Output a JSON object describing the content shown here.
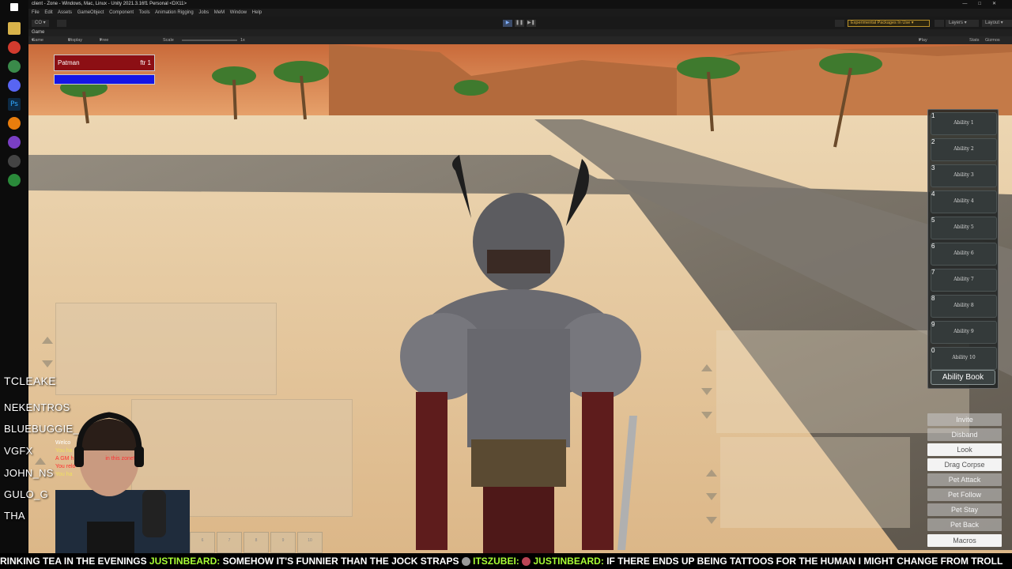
{
  "window": {
    "title": "client - Zone - Windows, Mac, Linux - Unity 2021.3.16f1 Personal <DX11>",
    "controls": [
      "—",
      "□",
      "✕"
    ]
  },
  "menu": [
    "File",
    "Edit",
    "Assets",
    "GameObject",
    "Component",
    "Tools",
    "Animation Rigging",
    "Jobs",
    "MeM",
    "Window",
    "Help"
  ],
  "toolbar": {
    "account": "CO",
    "experimental": "Experimental Packages In Use ▾",
    "layers": "Layers",
    "layout": "Layout"
  },
  "game_tab": {
    "label": "Game"
  },
  "game_controls": {
    "view": "Game",
    "display": "Display 1",
    "aspect": "Free Aspect",
    "scale_label": "Scale",
    "scale_value": "1x",
    "play_focused": "Play Focused",
    "stats": "Stats",
    "gizmos": "Gizmos"
  },
  "player": {
    "name": "Patman",
    "level_label": "ftr 1",
    "health_fraction": 1.0,
    "mana_fraction": 1.0
  },
  "abilities": [
    {
      "num": "1",
      "label": "Ability 1"
    },
    {
      "num": "2",
      "label": "Ability 2"
    },
    {
      "num": "3",
      "label": "Ability 3"
    },
    {
      "num": "4",
      "label": "Ability 4"
    },
    {
      "num": "5",
      "label": "Ability 5"
    },
    {
      "num": "6",
      "label": "Ability 6"
    },
    {
      "num": "7",
      "label": "Ability 7"
    },
    {
      "num": "8",
      "label": "Ability 8"
    },
    {
      "num": "9",
      "label": "Ability 9"
    },
    {
      "num": "0",
      "label": "Ability 10"
    }
  ],
  "ability_book": "Ability Book",
  "group_buttons": [
    {
      "label": "Invite",
      "enabled": false
    },
    {
      "label": "Disband",
      "enabled": false
    },
    {
      "label": "Look",
      "enabled": true
    },
    {
      "label": "Drag Corpse",
      "enabled": true
    },
    {
      "label": "Pet Attack",
      "enabled": false
    },
    {
      "label": "Pet Follow",
      "enabled": false
    },
    {
      "label": "Pet Stay",
      "enabled": false
    },
    {
      "label": "Pet Back",
      "enabled": false
    },
    {
      "label": "Macros",
      "enabled": true
    }
  ],
  "chat": [
    {
      "text": "Welco",
      "color": "#ffffff"
    },
    {
      "text": "You ha",
      "color": "#f0e060"
    },
    {
      "text": "A GM h",
      "color": "#ff3030"
    },
    {
      "text": "in this zone!",
      "color": "#ff3030"
    },
    {
      "text": "You relo",
      "color": "#ff3030"
    },
    {
      "text": "You ha",
      "color": "#f0e060"
    }
  ],
  "hotbar_slots": [
    "6",
    "7",
    "8",
    "9",
    "10"
  ],
  "stream": {
    "viewers": [
      "TCLEAKE",
      "NEKENTROS",
      "BLUEBUGGIE_",
      "VGFX",
      "JOHN_NS",
      "GULO_G",
      "THA"
    ],
    "ticker": [
      {
        "type": "msg",
        "text": "RINKING TEA IN THE EVENINGS "
      },
      {
        "type": "name",
        "text": "JUSTINBEARD:"
      },
      {
        "type": "msg",
        "text": " SOMEHOW IT'S FUNNIER THAN THE JOCK STRAPS "
      },
      {
        "type": "name",
        "text": "ITSZUBEI:"
      },
      {
        "type": "msg",
        "text": " "
      },
      {
        "type": "name",
        "text": "JUSTINBEARD:"
      },
      {
        "type": "msg",
        "text": " IF THERE ENDS UP BEING TATTOOS FOR THE HUMAN I MIGHT CHANGE FROM TROLL"
      }
    ]
  },
  "colors": {
    "hp": "#8c0f14",
    "mp": "#1515e6",
    "ticker_name": "#a8ff35",
    "sand": "#e6c9a0"
  }
}
